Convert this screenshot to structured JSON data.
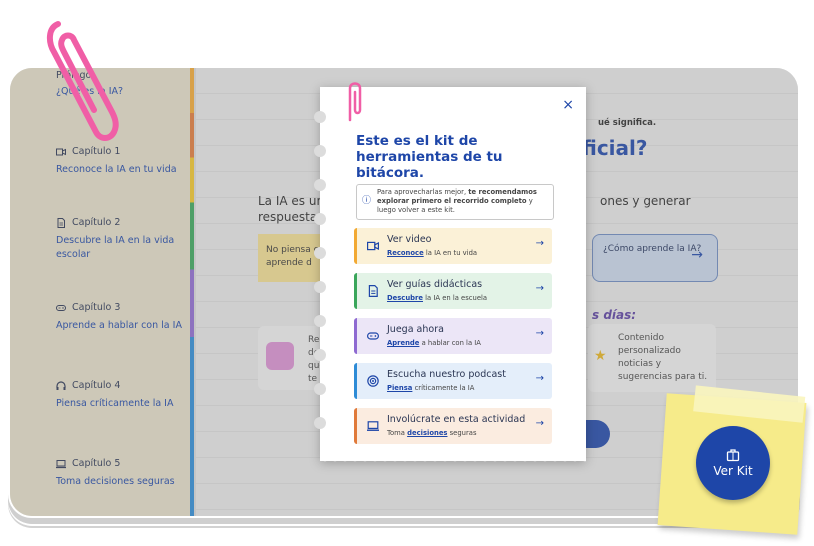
{
  "sidebar": {
    "prologue": {
      "head": "Prólogo",
      "link": "¿Qué es la IA?"
    },
    "chapters": [
      {
        "head": "Capítulo 1",
        "link": "Reconoce la IA en tu vida",
        "icon": "video-icon"
      },
      {
        "head": "Capítulo 2",
        "link": "Descubre la IA en la vida escolar",
        "icon": "document-icon"
      },
      {
        "head": "Capítulo 3",
        "link": "Aprende a hablar con la IA",
        "icon": "gamepad-icon"
      },
      {
        "head": "Capítulo 4",
        "link": "Piensa críticamente la IA",
        "icon": "headphones-icon"
      },
      {
        "head": "Capítulo 5",
        "link": "Toma decisiones seguras",
        "icon": "laptop-icon"
      }
    ]
  },
  "main": {
    "top_note": "ué significa.",
    "heading": "ficial?",
    "text_left_1": "La IA es una te",
    "text_left_2": "respuestas o",
    "text_right": "ones y generar",
    "yellow_note": "No piensa co aprende d",
    "blue_card": "¿Cómo aprende la IA?",
    "purple_sub": "s días:",
    "right_card": "Contenido personalizado noticias y sugerencias para ti.",
    "left_card": "Recom de que te"
  },
  "modal": {
    "close": "×",
    "title": "Este es el kit de herramientas de tu bitácora.",
    "info_pre": "Para aprovecharlas mejor, ",
    "info_bold": "te recomendamos explorar primero el recorrido completo",
    "info_post": " y luego volver a este kit.",
    "items": [
      {
        "title": "Ver video",
        "link": "Reconoce",
        "rest": " la IA en tu vida",
        "icon": "video-icon"
      },
      {
        "title": "Ver guías didácticas",
        "link": "Descubre",
        "rest": " la IA en la escuela",
        "icon": "document-icon"
      },
      {
        "title": "Juega ahora",
        "link": "Aprende",
        "rest": " a hablar con la IA",
        "icon": "gamepad-icon"
      },
      {
        "title": "Escucha nuestro podcast",
        "link": "Piensa",
        "rest": " críticamente la IA",
        "icon": "podcast-icon"
      },
      {
        "title": "Involúcrate en esta actividad",
        "pre": "Toma ",
        "link": "decisiones",
        "rest": " seguras",
        "icon": "laptop-icon"
      }
    ]
  },
  "ver_kit": {
    "label": "Ver Kit",
    "icon": "briefcase-icon"
  },
  "colors": {
    "brand": "#1e46a8",
    "note": "#f6eb8a",
    "clip": "#f05ea6"
  }
}
